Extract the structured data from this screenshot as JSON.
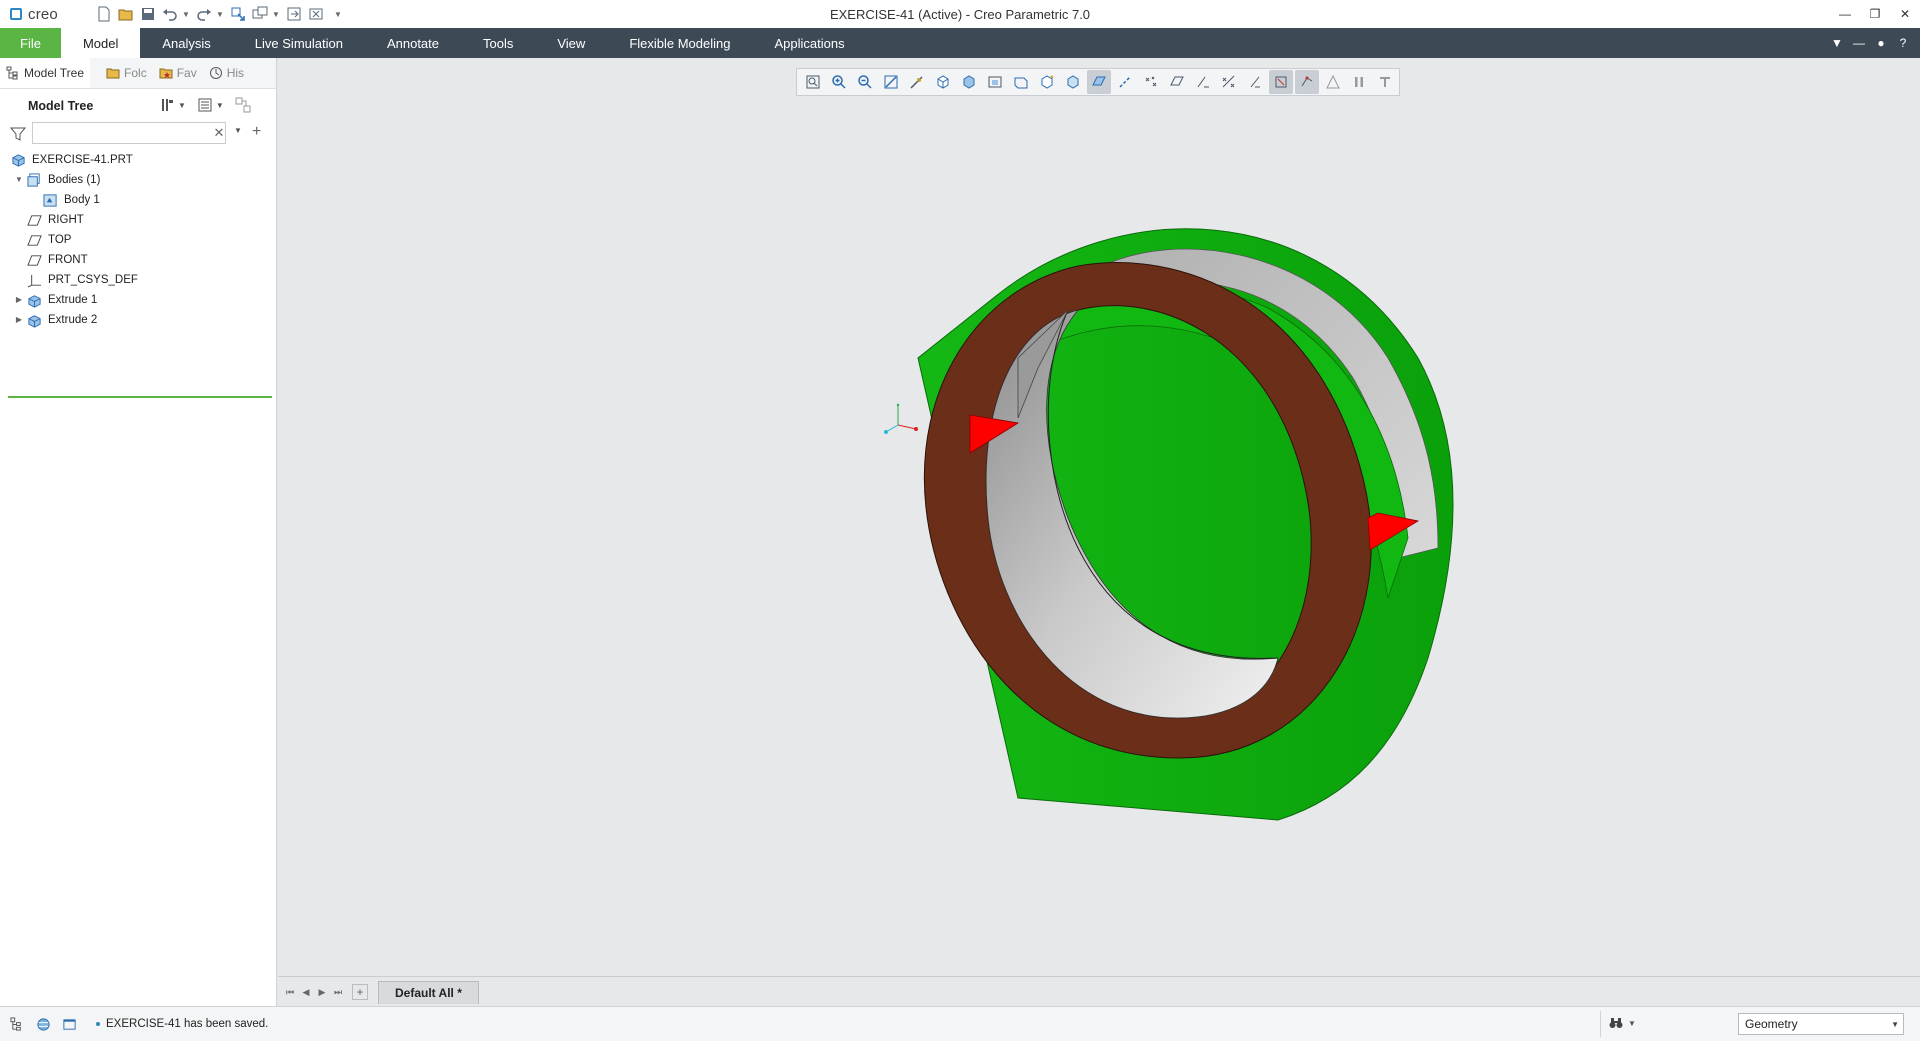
{
  "app": {
    "brand": "creo",
    "window_title": "EXERCISE-41 (Active) - Creo Parametric 7.0"
  },
  "ribbon": {
    "file": "File",
    "tabs": [
      "Model",
      "Analysis",
      "Live Simulation",
      "Annotate",
      "Tools",
      "View",
      "Flexible Modeling",
      "Applications"
    ],
    "active_tab": "Model"
  },
  "left_panel": {
    "tabs": [
      "Model Tree",
      "Folc",
      "Fav",
      "His"
    ],
    "title": "Model Tree",
    "search": {
      "value": "",
      "placeholder": ""
    },
    "tree": [
      {
        "label": "EXERCISE-41.PRT",
        "icon": "part-icon",
        "level": 0
      },
      {
        "label": "Bodies (1)",
        "icon": "bodies-icon",
        "level": 1,
        "expander": "▼"
      },
      {
        "label": "Body 1",
        "icon": "body-icon",
        "level": 2
      },
      {
        "label": "RIGHT",
        "icon": "datum-plane-icon",
        "level": 1
      },
      {
        "label": "TOP",
        "icon": "datum-plane-icon",
        "level": 1
      },
      {
        "label": "FRONT",
        "icon": "datum-plane-icon",
        "level": 1
      },
      {
        "label": "PRT_CSYS_DEF",
        "icon": "csys-icon",
        "level": 1
      },
      {
        "label": "Extrude 1",
        "icon": "extrude-icon",
        "level": 1,
        "expander": "▶"
      },
      {
        "label": "Extrude 2",
        "icon": "extrude-icon",
        "level": 1,
        "expander": "▶"
      }
    ]
  },
  "graphics": {
    "colors": {
      "brown": "#6b2e18",
      "green": "#19c219",
      "red": "#ff0000",
      "grey": "#b8b8b8"
    }
  },
  "bottom": {
    "tab_label": "Default All *"
  },
  "status": {
    "message": "EXERCISE-41 has been saved.",
    "filter_value": "Geometry"
  },
  "colors": {
    "ribbon_bg": "#3d4a56",
    "file_tab": "#5bb545",
    "accent": "#2b86c5"
  }
}
